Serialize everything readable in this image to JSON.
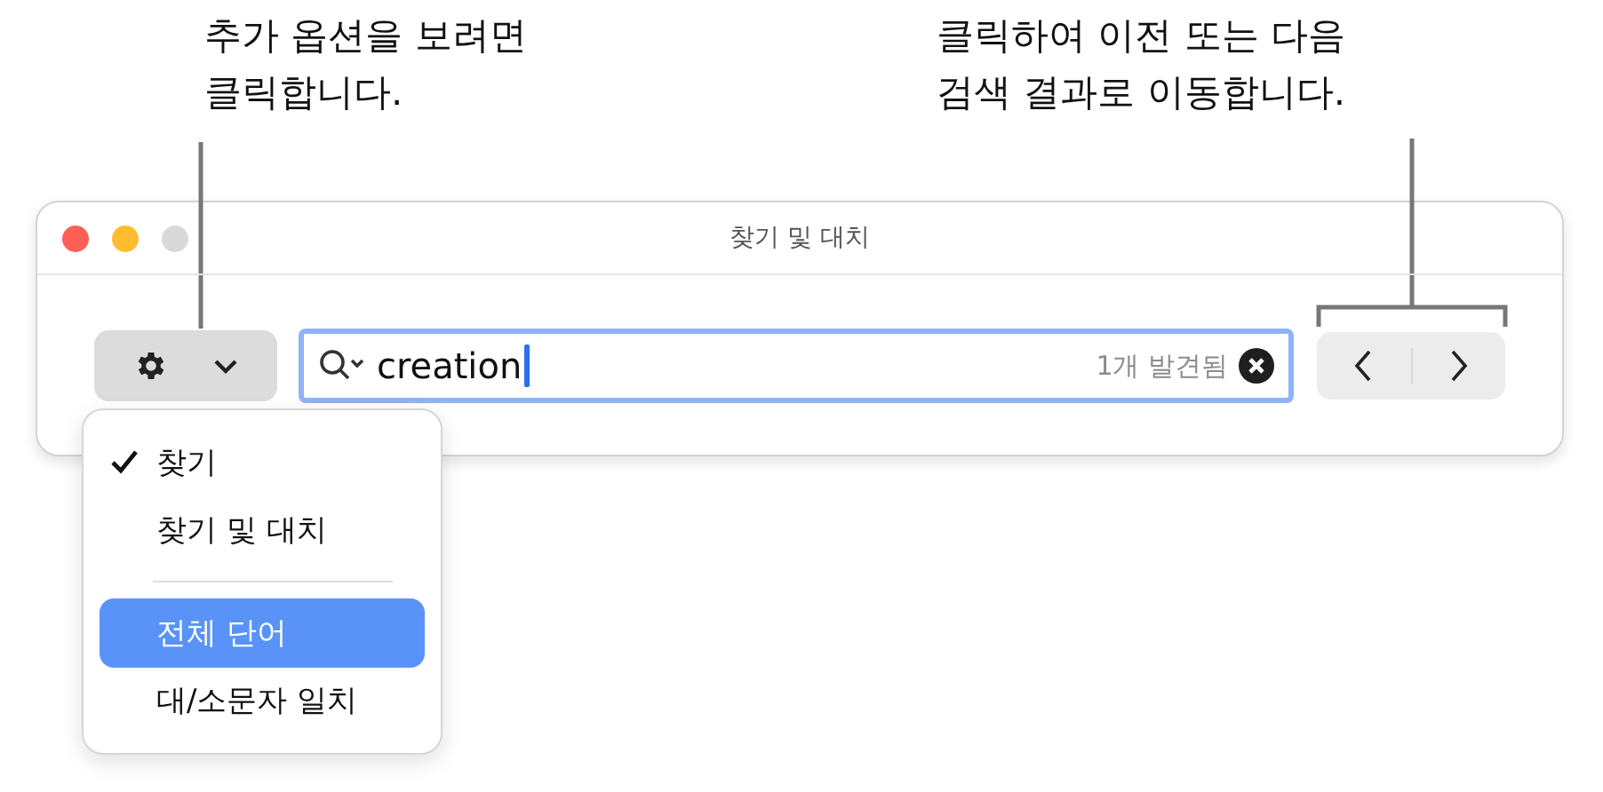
{
  "callouts": [
    {
      "lines": [
        "추가 옵션을 보려면",
        "클릭합니다."
      ]
    },
    {
      "lines": [
        "클릭하여 이전 또는 다음",
        "검색 결과로 이동합니다."
      ]
    }
  ],
  "window": {
    "title": "찾기 및 대치"
  },
  "search": {
    "value": "creation",
    "match_count": "1개 발견됨"
  },
  "menu": {
    "items": [
      {
        "kind": "item",
        "label": "찾기",
        "checked": true,
        "selected": false
      },
      {
        "kind": "item",
        "label": "찾기 및 대치",
        "checked": false,
        "selected": false
      },
      {
        "kind": "separator"
      },
      {
        "kind": "item",
        "label": "전체 단어",
        "checked": false,
        "selected": true
      },
      {
        "kind": "item",
        "label": "대/소문자 일치",
        "checked": false,
        "selected": false
      }
    ]
  }
}
